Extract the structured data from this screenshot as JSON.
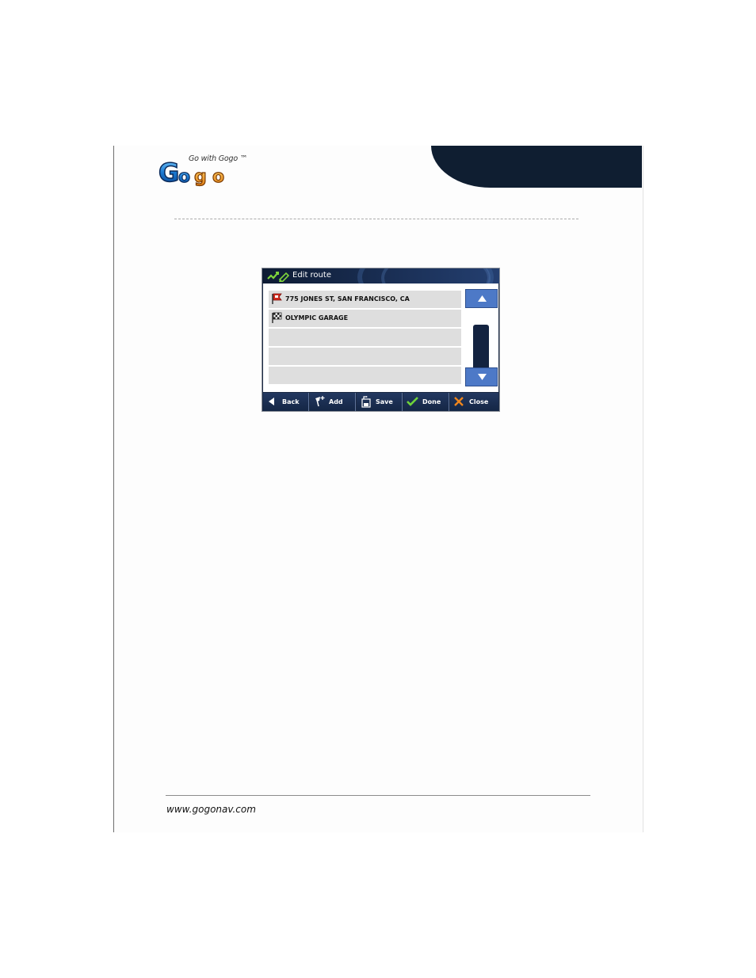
{
  "brand": {
    "tagline": "Go with Gogo ™",
    "logo_text": "Gogo"
  },
  "screen": {
    "title": "Edit route",
    "route_items": [
      {
        "icon": "red-flag-icon",
        "label": "775 JONES ST, SAN FRANCISCO, CA"
      },
      {
        "icon": "checkered-flag-icon",
        "label": "OLYMPIC GARAGE"
      },
      {
        "icon": "",
        "label": ""
      },
      {
        "icon": "",
        "label": ""
      },
      {
        "icon": "",
        "label": ""
      }
    ],
    "toolbar": {
      "back_label": "Back",
      "add_label": "Add",
      "save_label": "Save",
      "done_label": "Done",
      "close_label": "Close"
    }
  },
  "footer": {
    "url": "www.gogonav.com"
  },
  "colors": {
    "corner_tab": "#0f1e31",
    "scroll_button": "#4d79c7",
    "toolbar": "#1a2d50",
    "row_background": "#dedede"
  }
}
